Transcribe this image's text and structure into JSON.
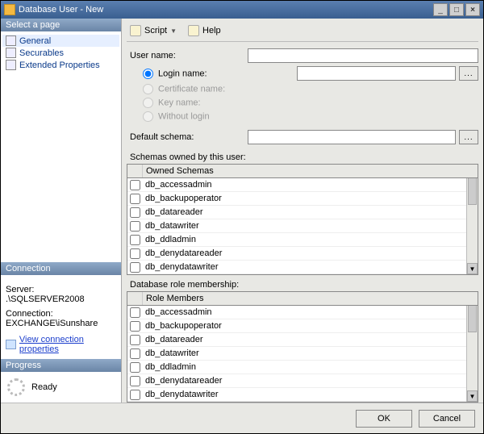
{
  "title": "Database User - New",
  "window_buttons": {
    "minimize": "_",
    "maximize": "□",
    "close": "×"
  },
  "toolbar": {
    "script_label": "Script",
    "help_label": "Help"
  },
  "sidebar": {
    "select_page_title": "Select a page",
    "items": [
      {
        "label": "General",
        "active": true
      },
      {
        "label": "Securables",
        "active": false
      },
      {
        "label": "Extended Properties",
        "active": false
      }
    ],
    "connection_title": "Connection",
    "server_label": "Server:",
    "server_value": ".\\SQLSERVER2008",
    "connection_label": "Connection:",
    "connection_value": "EXCHANGE\\iSunshare",
    "view_conn_link": "View connection properties",
    "progress_title": "Progress",
    "progress_status": "Ready"
  },
  "form": {
    "user_name_label": "User name:",
    "login_name_label": "Login name:",
    "certificate_name_label": "Certificate name:",
    "key_name_label": "Key name:",
    "without_login_label": "Without login",
    "default_schema_label": "Default schema:",
    "browse_label": "...",
    "user_name_value": "",
    "login_name_value": "",
    "default_schema_value": ""
  },
  "schemas": {
    "section_label": "Schemas owned by this user:",
    "column_header": "Owned Schemas",
    "items": [
      {
        "name": "db_accessadmin",
        "checked": false
      },
      {
        "name": "db_backupoperator",
        "checked": false
      },
      {
        "name": "db_datareader",
        "checked": false
      },
      {
        "name": "db_datawriter",
        "checked": false
      },
      {
        "name": "db_ddladmin",
        "checked": false
      },
      {
        "name": "db_denydatareader",
        "checked": false
      },
      {
        "name": "db_denydatawriter",
        "checked": false
      }
    ]
  },
  "roles": {
    "section_label": "Database role membership:",
    "column_header": "Role Members",
    "items": [
      {
        "name": "db_accessadmin",
        "checked": false
      },
      {
        "name": "db_backupoperator",
        "checked": false
      },
      {
        "name": "db_datareader",
        "checked": false
      },
      {
        "name": "db_datawriter",
        "checked": false
      },
      {
        "name": "db_ddladmin",
        "checked": false
      },
      {
        "name": "db_denydatareader",
        "checked": false
      },
      {
        "name": "db_denydatawriter",
        "checked": false
      }
    ]
  },
  "footer": {
    "ok_label": "OK",
    "cancel_label": "Cancel"
  }
}
